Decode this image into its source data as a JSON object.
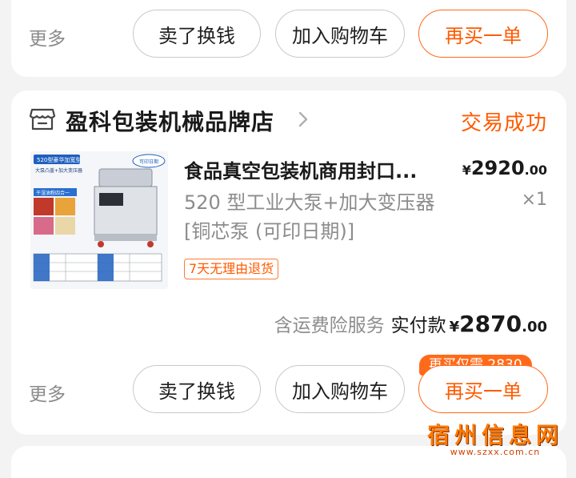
{
  "top_order": {
    "more_label": "更多",
    "sell_label": "卖了换钱",
    "cart_label": "加入购物车",
    "rebuy_label": "再买一单"
  },
  "order": {
    "shop_name": "盈科包装机械品牌店",
    "status": "交易成功",
    "product": {
      "title": "食品真空包装机商用封口...",
      "spec": "520 型工业大泵+加大变压器[铜芯泵 (可印日期)]",
      "price_currency": "¥",
      "price_integer": "2920",
      "price_decimal": ".00",
      "quantity": "×1",
      "tag": "7天无理由退货",
      "image_text": {
        "badge": "520型豪华加宽型",
        "subtitle": "大泵凸盖+加大变压器",
        "stamp": "可印日期",
        "feature": "干湿油粉四合一"
      }
    },
    "service_label": "含运费险服务",
    "paid_label": "实付款",
    "paid_currency": "¥",
    "paid_integer": "2870",
    "paid_decimal": ".00",
    "more_label": "更多",
    "sell_label": "卖了换钱",
    "cart_label": "加入购物车",
    "rebuy_label": "再买一单",
    "rebuy_hint": "再买仅需 2830"
  },
  "watermark": {
    "text": "宿州信息网",
    "url": "www.szxx.com.cn"
  },
  "colors": {
    "accent": "#ff5a00",
    "background": "#f3f3f3",
    "card": "#ffffff",
    "muted_text": "#8c8c8c"
  }
}
